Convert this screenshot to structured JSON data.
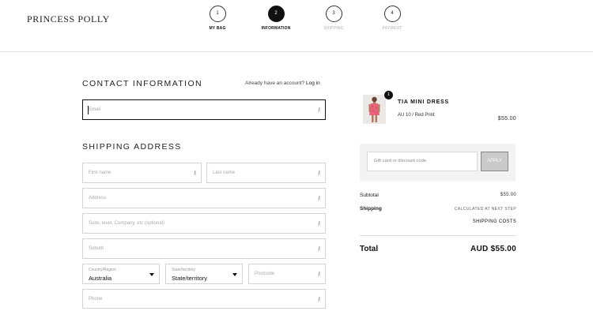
{
  "header": {
    "logo": "PRINCESS POLLY",
    "steps": [
      {
        "number": "1",
        "label": "MY BAG"
      },
      {
        "number": "2",
        "label": "INFORMATION"
      },
      {
        "number": "3",
        "label": "SHIPPING"
      },
      {
        "number": "4",
        "label": "PAYMENT"
      }
    ]
  },
  "contact": {
    "title": "CONTACT INFORMATION",
    "account_prompt": "Already have an account?",
    "login_label": "Log in",
    "email_placeholder": "Email"
  },
  "shipping": {
    "title": "SHIPPING ADDRESS",
    "first_name_placeholder": "First name",
    "last_name_placeholder": "Last name",
    "address_placeholder": "Address",
    "suite_placeholder": "Suite, level, Company, etc (optional)",
    "suburb_placeholder": "Suburb",
    "country_label": "Country/Region",
    "country_value": "Australia",
    "state_label": "State/territory",
    "state_value": "State/territory",
    "postcode_placeholder": "Postcode",
    "phone_placeholder": "Phone"
  },
  "order": {
    "quantity": "1",
    "product_name": "TIA MINI DRESS",
    "product_variant": "AU 10 / Red Print",
    "product_price": "$55.00",
    "discount_placeholder": "Gift card or discount code",
    "apply_label": "APPLY",
    "subtotal_label": "Subtotal",
    "subtotal_value": "$55.00",
    "shipping_label": "Shipping",
    "shipping_value": "CALCULATED AT NEXT STEP",
    "shipping_costs": "SHIPPING COSTS",
    "total_label": "Total",
    "total_value": "AUD  $55.00"
  },
  "colors": {
    "primary": "#111111",
    "border": "#d4d4d4",
    "summary_bg": "#f3f3f3"
  }
}
